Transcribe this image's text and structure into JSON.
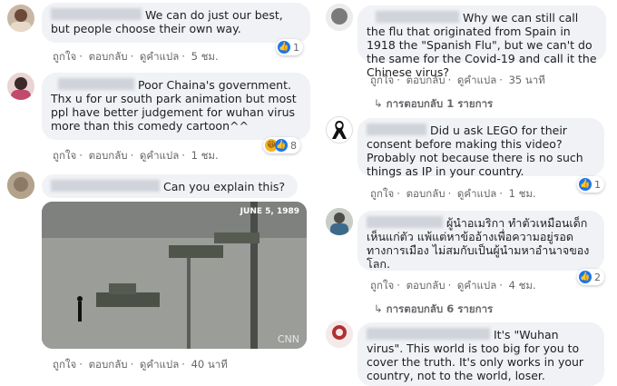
{
  "actions": {
    "like": "ถูกใจ",
    "reply": "ตอบกลับ",
    "translate": "ดูคำแปล"
  },
  "left": [
    {
      "text": "We can do just our best, but people choose their own way.",
      "time": "5 ชม.",
      "reactions": "1"
    },
    {
      "text": "Poor Chaina's government. Thx u for ur south park animation but most ppl have better judgement for wuhan virus more than this comedy cartoon^^",
      "time": "1 ชม.",
      "reactions": "8"
    },
    {
      "text": "Can you explain this?",
      "time": "40 นาที",
      "photo_caption": "JUNE 5, 1989",
      "photo_watermark": "CNN"
    }
  ],
  "right": [
    {
      "text": "Why we can still call the flu that originated from Spain in 1918 the \"Spanish Flu\", but we can't do the same for the Covid-19 and call it the Chinese virus?",
      "time": "35 นาที",
      "replies": "การตอบกลับ 1 รายการ"
    },
    {
      "text": "Did u ask LEGO for their consent before making this video? Probably not because there is no such things as IP in your country.",
      "time": "1 ชม.",
      "reactions": "1"
    },
    {
      "text": "ผู้นำอเมริกา ทำตัวเหมือนเด็ก เห็นแก่ตัว แพ้แต่หาข้ออ้างเพื่อความอยู่รอดทางการเมือง ไม่สมกับเป็นผู้นำมหาอำนาจของโลก.",
      "time": "4 ชม.",
      "reactions": "2",
      "replies": "การตอบกลับ 6 รายการ"
    },
    {
      "text": "It's \"Wuhan virus\". This world is too big for you to cover the truth. It's only works in your country, not to the world, loser."
    }
  ],
  "colors": {
    "like": "#1877f2",
    "bubble": "#f0f2f5",
    "meta": "#65676b"
  }
}
